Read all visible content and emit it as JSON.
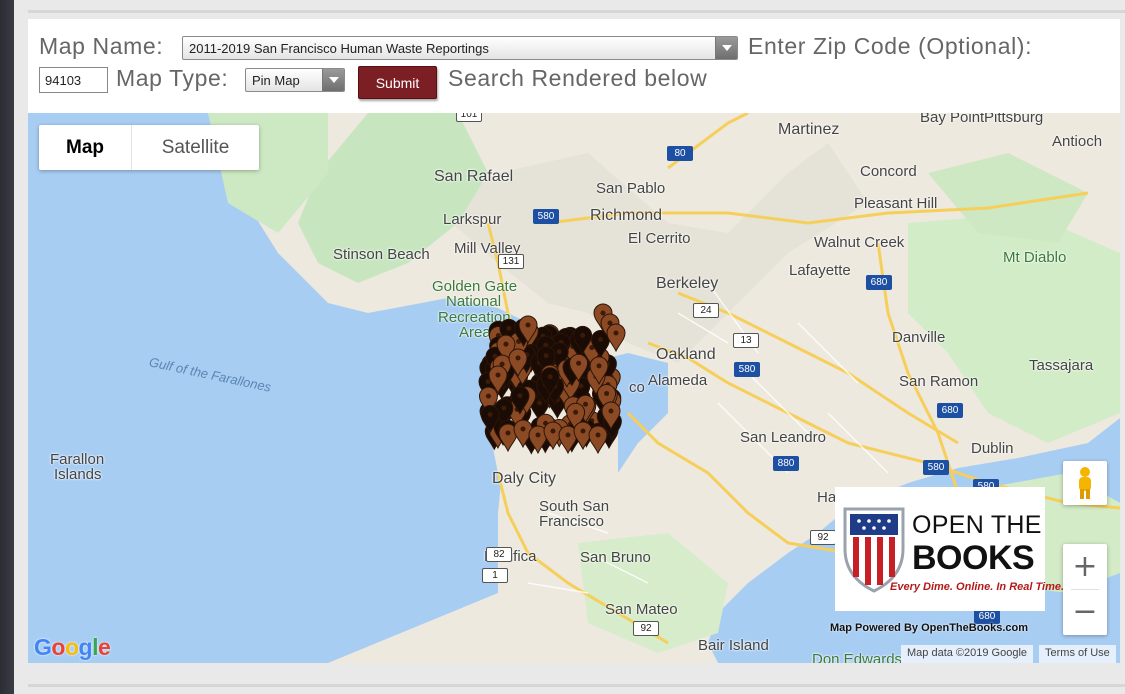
{
  "form": {
    "map_name_label": "Map Name:",
    "map_name_value": "2011-2019 San Francisco Human Waste Reportings",
    "zip_label": "Enter Zip Code (Optional):",
    "zip_value": "94103",
    "map_type_label": "Map Type:",
    "map_type_value": "Pin Map",
    "submit_label": "Submit",
    "rendered_text": "Search Rendered below"
  },
  "map": {
    "type_control": {
      "map_label": "Map",
      "satellite_label": "Satellite",
      "selected": "Map"
    },
    "zoom_in_label": "+",
    "zoom_out_label": "−",
    "places": [
      {
        "label": "Martinez",
        "kind": "city"
      },
      {
        "label": "Bay Point",
        "kind": "city"
      },
      {
        "label": "Pittsburg",
        "kind": "city"
      },
      {
        "label": "Antioch",
        "kind": "city"
      },
      {
        "label": "San Rafael",
        "kind": "city"
      },
      {
        "label": "San Pablo",
        "kind": "city"
      },
      {
        "label": "Concord",
        "kind": "city"
      },
      {
        "label": "Pleasant Hill",
        "kind": "city"
      },
      {
        "label": "Larkspur",
        "kind": "city"
      },
      {
        "label": "Richmond",
        "kind": "city"
      },
      {
        "label": "El Cerrito",
        "kind": "city"
      },
      {
        "label": "Mill Valley",
        "kind": "city"
      },
      {
        "label": "Walnut Creek",
        "kind": "city"
      },
      {
        "label": "Stinson Beach",
        "kind": "city"
      },
      {
        "label": "Lafayette",
        "kind": "city"
      },
      {
        "label": "Mt Diablo",
        "kind": "park"
      },
      {
        "label": "Golden Gate",
        "kind": "park"
      },
      {
        "label": "National",
        "kind": "park"
      },
      {
        "label": "Recreation",
        "kind": "park"
      },
      {
        "label": "Area",
        "kind": "park"
      },
      {
        "label": "Berkeley",
        "kind": "city"
      },
      {
        "label": "Danville",
        "kind": "city"
      },
      {
        "label": "Oakland",
        "kind": "city"
      },
      {
        "label": "Alameda",
        "kind": "city"
      },
      {
        "label": "Tassajara",
        "kind": "city"
      },
      {
        "label": "San Ramon",
        "kind": "city"
      },
      {
        "label": "Gulf of the Farallones",
        "kind": "water"
      },
      {
        "label": "San Leandro",
        "kind": "city"
      },
      {
        "label": "Dublin",
        "kind": "city"
      },
      {
        "label": "Farallon",
        "kind": "city"
      },
      {
        "label": "Islands",
        "kind": "city"
      },
      {
        "label": "Daly City",
        "kind": "city"
      },
      {
        "label": "South San",
        "kind": "city"
      },
      {
        "label": "Francisco",
        "kind": "city"
      },
      {
        "label": "Pacifica",
        "kind": "city"
      },
      {
        "label": "San Bruno",
        "kind": "city"
      },
      {
        "label": "San Mateo",
        "kind": "city"
      },
      {
        "label": "Bair Island",
        "kind": "city"
      },
      {
        "label": "Don Edwards",
        "kind": "park"
      },
      {
        "label": "Ha",
        "kind": "city"
      },
      {
        "label": "co",
        "kind": "city"
      }
    ],
    "highways": [
      "101",
      "80",
      "580",
      "131",
      "24",
      "13",
      "580",
      "680",
      "680",
      "680",
      "880",
      "580",
      "580",
      "92",
      "82",
      "1",
      "92",
      "680"
    ],
    "pin_color": "#8b4a24",
    "google_logo": "Google",
    "map_data": "Map data ©2019 Google",
    "terms": "Terms of Use"
  },
  "branding": {
    "title_line1": "OPEN THE",
    "title_line2": "BOOKS",
    "tagline": "Every Dime. Online. In Real Time.",
    "powered_by": "Map Powered By OpenTheBooks.com"
  }
}
